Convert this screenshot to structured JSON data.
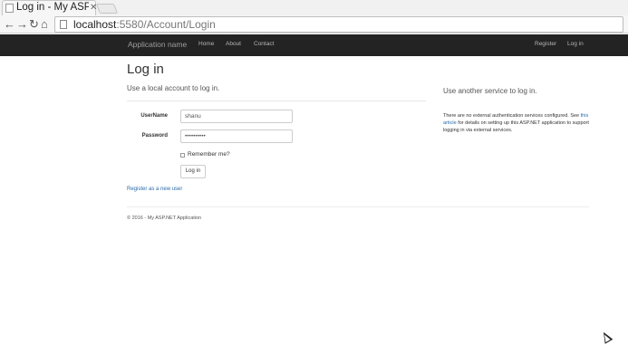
{
  "browser": {
    "tab_title": "Log in - My ASP.NET",
    "url_host": "localhost",
    "url_rest": ":5580/Account/Login",
    "icons": [
      "back-icon",
      "forward-icon",
      "reload-icon",
      "home-icon",
      "page-icon",
      "close-icon"
    ]
  },
  "navbar": {
    "brand": "Application name",
    "links": [
      "Home",
      "About",
      "Contact"
    ],
    "right_links": [
      "Register",
      "Log in"
    ]
  },
  "page": {
    "title": "Log in",
    "subtitle": "Use a local account to log in.",
    "external_heading": "Use another service to log in."
  },
  "form": {
    "username_label": "UserName",
    "username_value": "shanu",
    "password_label": "Password",
    "password_value": "••••••••••",
    "remember_label": "Remember me?",
    "submit_label": "Log in",
    "register_link": "Register as a new user"
  },
  "external": {
    "text_before": "There are no external authentication services configured. See ",
    "link_text": "this article",
    "text_after": " for details on setting up this ASP.NET application to support logging in via external services."
  },
  "footer": {
    "text": "© 2016 - My ASP.NET Application"
  },
  "colors": {
    "navbar": "#232323",
    "link": "#2a6aa8"
  }
}
